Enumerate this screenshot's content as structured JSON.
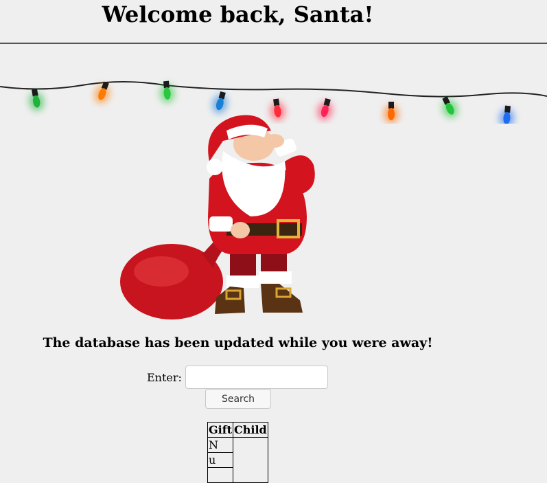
{
  "header": {
    "title": "Welcome back, Santa!"
  },
  "lights": {
    "colors": [
      "#1fb33a",
      "#ff7a00",
      "#29c63f",
      "#1a7fd6",
      "#ff2a3a",
      "#ff2255",
      "#ff6a00",
      "#22c43a",
      "#1e6df0"
    ]
  },
  "notice": {
    "text": "The database has been updated while you were away!"
  },
  "search": {
    "label": "Enter:",
    "value": "",
    "placeholder": "",
    "button_label": "Search"
  },
  "results": {
    "headers": [
      "Gift",
      "Child"
    ],
    "rows": [
      [
        "N",
        ""
      ],
      [
        "u",
        ""
      ]
    ]
  }
}
